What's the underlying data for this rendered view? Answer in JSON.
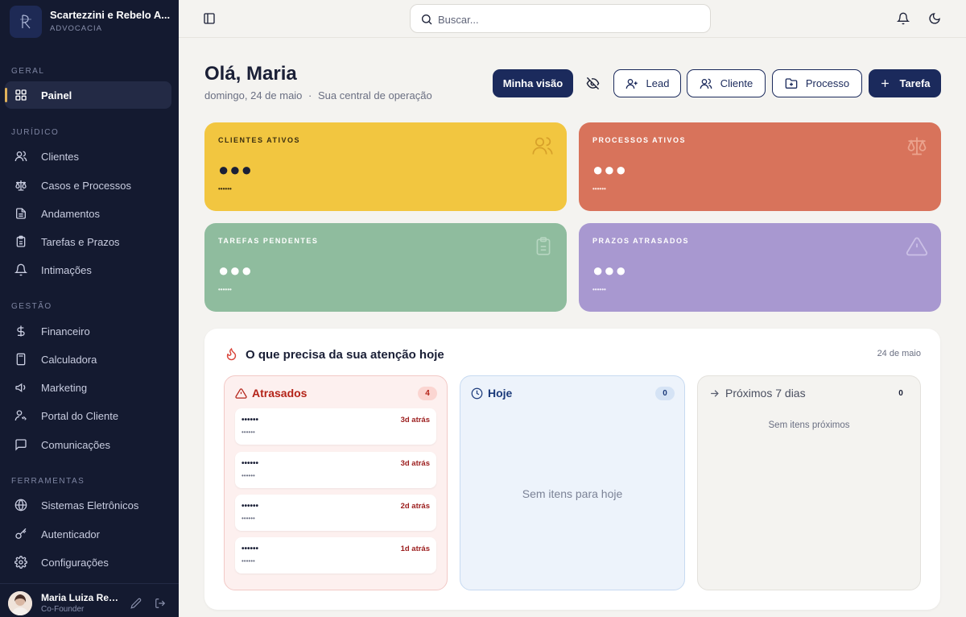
{
  "brand": {
    "name": "Scartezzini e Rebelo A...",
    "subtitle": "ADVOCACIA"
  },
  "sidebar": {
    "sections": {
      "geral": "GERAL",
      "juridico": "JURÍDICO",
      "gestao": "GESTÃO",
      "ferramentas": "FERRAMENTAS"
    },
    "items": [
      {
        "label": "Painel",
        "icon": "grid-icon"
      },
      {
        "label": "Clientes",
        "icon": "users-icon"
      },
      {
        "label": "Casos e Processos",
        "icon": "scale-icon"
      },
      {
        "label": "Andamentos",
        "icon": "document-icon"
      },
      {
        "label": "Tarefas e Prazos",
        "icon": "clipboard-icon"
      },
      {
        "label": "Intimações",
        "icon": "bell-icon"
      },
      {
        "label": "Financeiro",
        "icon": "dollar-icon"
      },
      {
        "label": "Calculadora",
        "icon": "calculator-icon"
      },
      {
        "label": "Marketing",
        "icon": "megaphone-icon"
      },
      {
        "label": "Portal do Cliente",
        "icon": "user-key-icon"
      },
      {
        "label": "Comunicações",
        "icon": "chat-icon"
      },
      {
        "label": "Sistemas Eletrônicos",
        "icon": "globe-icon"
      },
      {
        "label": "Autenticador",
        "icon": "key-icon"
      },
      {
        "label": "Configurações",
        "icon": "gear-icon"
      }
    ],
    "active": "Painel"
  },
  "user": {
    "name": "Maria Luiza Reb...",
    "role": "Co-Founder"
  },
  "topbar": {
    "search_placeholder": "Buscar..."
  },
  "header": {
    "greeting": "Olá, Maria",
    "date": "domingo, 24 de maio",
    "separator": "·",
    "subtitle": "Sua central de operação"
  },
  "actions": {
    "minha_visao": "Minha visão",
    "lead": "Lead",
    "cliente": "Cliente",
    "processo": "Processo",
    "tarefa": "Tarefa"
  },
  "stats": [
    {
      "title": "CLIENTES ATIVOS",
      "value": "●●●",
      "sub": "••••••",
      "color": "#f2c640"
    },
    {
      "title": "PROCESSOS ATIVOS",
      "value": "●●●",
      "sub": "••••••",
      "color": "#d8735b"
    },
    {
      "title": "TAREFAS PENDENTES",
      "value": "●●●",
      "sub": "••••••",
      "color": "#8fbc9e"
    },
    {
      "title": "PRAZOS ATRASADOS",
      "value": "●●●",
      "sub": "••••••",
      "color": "#a898d0"
    }
  ],
  "attention": {
    "title": "O que precisa da sua atenção hoje",
    "date": "24 de maio",
    "columns": {
      "atrasados": {
        "label": "Atrasados",
        "count": "4",
        "items": [
          {
            "title": "••••••",
            "sub": "••••••",
            "age": "3d atrás"
          },
          {
            "title": "••••••",
            "sub": "••••••",
            "age": "3d atrás"
          },
          {
            "title": "••••••",
            "sub": "••••••",
            "age": "2d atrás"
          },
          {
            "title": "••••••",
            "sub": "••••••",
            "age": "1d atrás"
          }
        ]
      },
      "hoje": {
        "label": "Hoje",
        "count": "0",
        "empty": "Sem itens para hoje"
      },
      "proximos": {
        "label": "Próximos 7 dias",
        "count": "0",
        "empty": "Sem itens próximos"
      }
    }
  }
}
